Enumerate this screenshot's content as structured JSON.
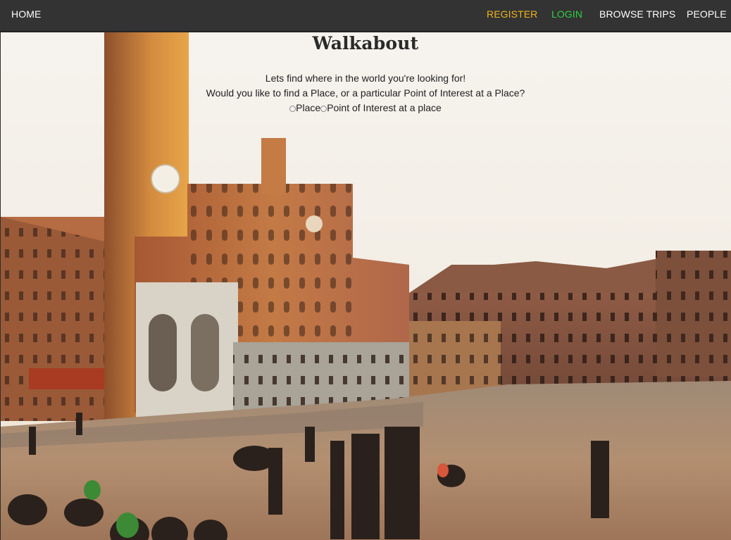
{
  "nav": {
    "home": "HOME",
    "register": "REGISTER",
    "login": "LOGIN",
    "browse_trips": "BROWSE TRIPS",
    "people": "PEOPLE"
  },
  "hero": {
    "title": "Walkabout",
    "line1": "Lets find where in the world you're looking for!",
    "line2": "Would you like to find a Place, or a particular Point of Interest at a Place?"
  },
  "search_type": {
    "options": [
      {
        "label": "Place",
        "selected": false
      },
      {
        "label": "Point of Interest at a place",
        "selected": false
      }
    ]
  },
  "background": {
    "description_icon": "town-square-photo",
    "sky_color": "#f4efe6",
    "brick_color": "#a45a33",
    "tower_color": "#c07a3c",
    "ground_color": "#b08d6d"
  }
}
